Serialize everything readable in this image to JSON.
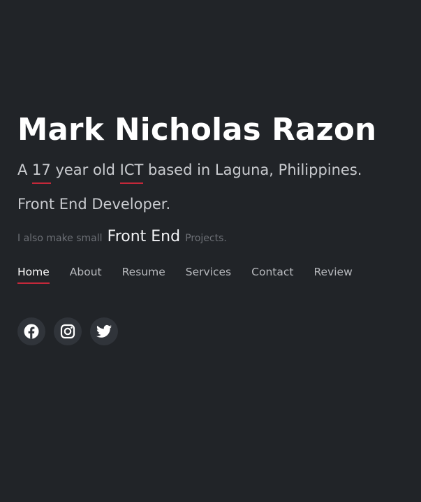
{
  "hero": {
    "name": "Mark Nicholas Razon",
    "tagline": {
      "prefix": "A ",
      "age": "17",
      "mid": " year old ",
      "course": "ICT",
      "suffix": " based in Laguna, Philippines."
    },
    "role": "Front End Developer.",
    "projects": {
      "lead": "I also make small",
      "highlight": "Front End",
      "tail": "Projects."
    }
  },
  "nav": {
    "items": [
      {
        "label": "Home",
        "active": true
      },
      {
        "label": "About"
      },
      {
        "label": "Resume"
      },
      {
        "label": "Services"
      },
      {
        "label": "Contact"
      },
      {
        "label": "Review"
      }
    ]
  },
  "socials": [
    {
      "icon": "facebook-icon"
    },
    {
      "icon": "instagram-icon"
    },
    {
      "icon": "twitter-icon"
    }
  ],
  "colors": {
    "background": "#212428",
    "accent": "#c4283a",
    "text": "#ffffff",
    "muted": "#c9cbcf",
    "social_bg": "#30343a"
  }
}
